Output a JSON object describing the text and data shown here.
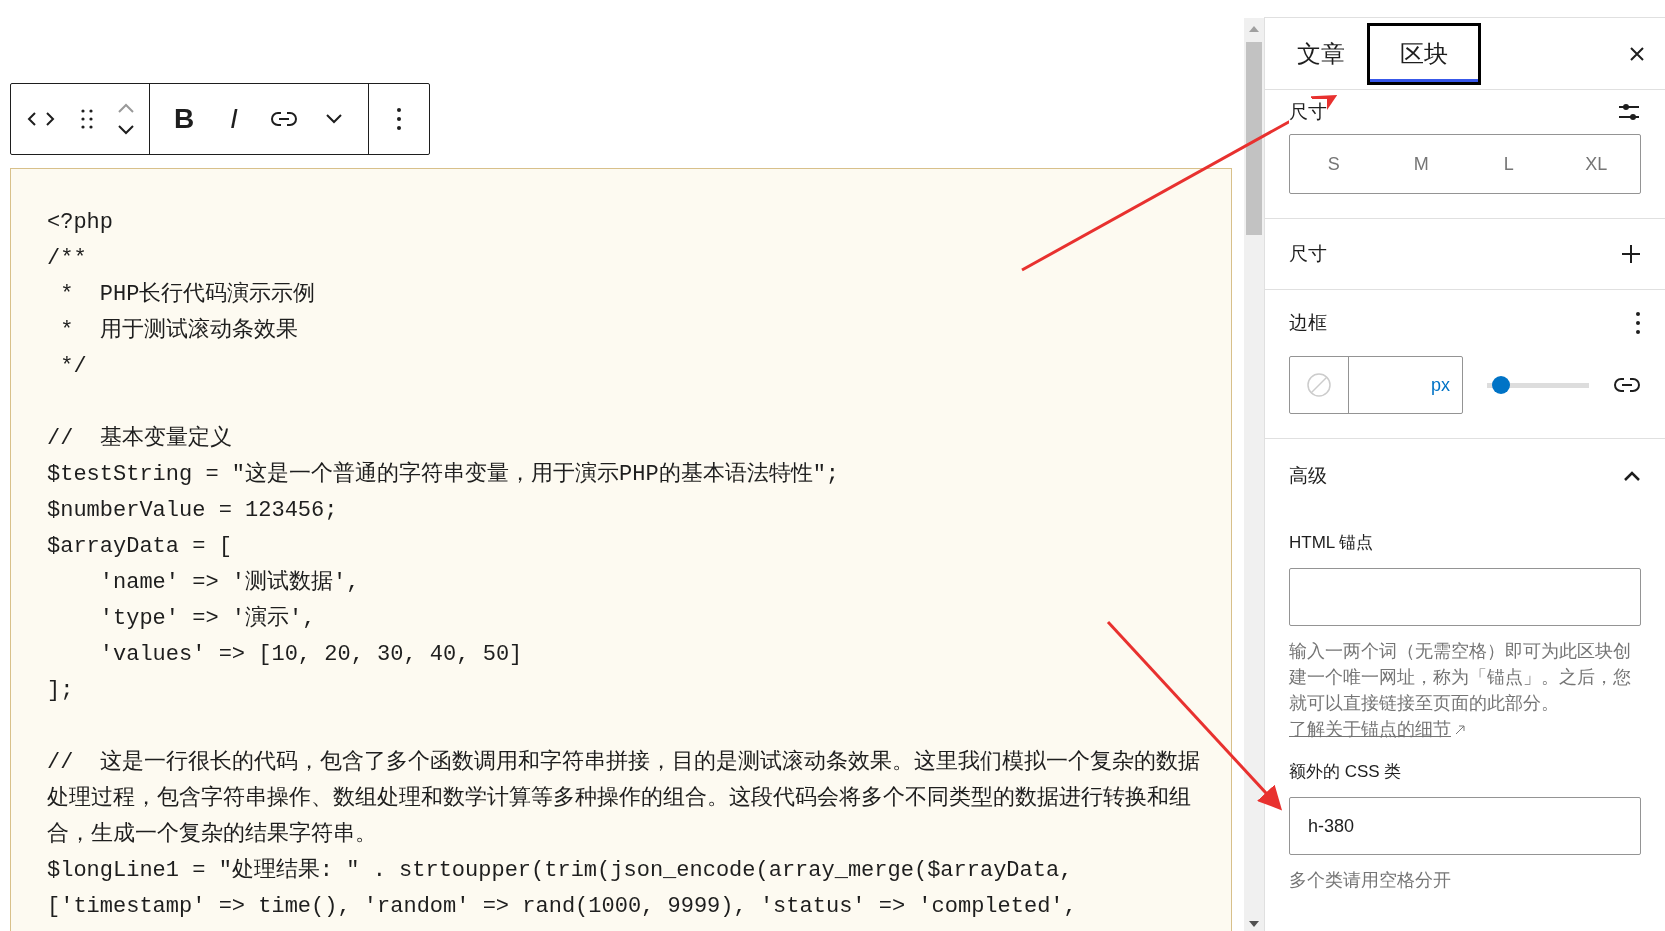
{
  "toolbar": {
    "bold_label": "B",
    "italic_label": "I"
  },
  "code_blocks": [
    [
      "<?php",
      "/**",
      " *  PHP长行代码演示示例",
      " *  用于测试滚动条效果",
      " */"
    ],
    [
      "//  基本变量定义",
      "$testString = \"这是一个普通的字符串变量，用于演示PHP的基本语法特性\";",
      "$numberValue = 123456;",
      "$arrayData = [",
      "    'name' => '测试数据',",
      "    'type' => '演示',",
      "    'values' => [10, 20, 30, 40, 50]",
      "];"
    ],
    [
      "//  这是一行很长的代码，包含了多个函数调用和字符串拼接，目的是测试滚动条效果。这里我们模拟一个复杂的数据处理过程，包含字符串操作、数组处理和数学计算等多种操作的组合。这段代码会将多个不同类型的数据进行转换和组合，生成一个复杂的结果字符串。",
      "$longLine1 = \"处理结果: \" . strtoupper(trim(json_encode(array_merge($arrayData, ['timestamp' => time(), 'random' => rand(1000, 9999), 'status' => 'completed',"
    ]
  ],
  "sidebar": {
    "tabs": [
      {
        "label": "文章",
        "selected": false
      },
      {
        "label": "区块",
        "selected": true
      }
    ],
    "size_presets": {
      "label": "尺寸",
      "options": [
        {
          "label": "S",
          "selected": false
        },
        {
          "label": "M",
          "selected": false
        },
        {
          "label": "L",
          "selected": false
        },
        {
          "label": "XL",
          "selected": false
        }
      ]
    },
    "dimensions": {
      "label": "尺寸",
      "expanded": false
    },
    "border": {
      "label": "边框",
      "unit": "px",
      "level": 0.05
    },
    "advanced": {
      "label": "高级",
      "expanded": true,
      "anchor_label": "HTML 锚点",
      "anchor_help": "输入一两个词（无需空格）即可为此区块创建一个唯一网址，称为「锚点」。之后，您就可以直接链接至页面的此部分。",
      "anchor_link": "了解关于锚点的细节",
      "css_label": "额外的 CSS 类",
      "css_value": "h-380",
      "css_help": "多个类请用空格分开"
    }
  }
}
